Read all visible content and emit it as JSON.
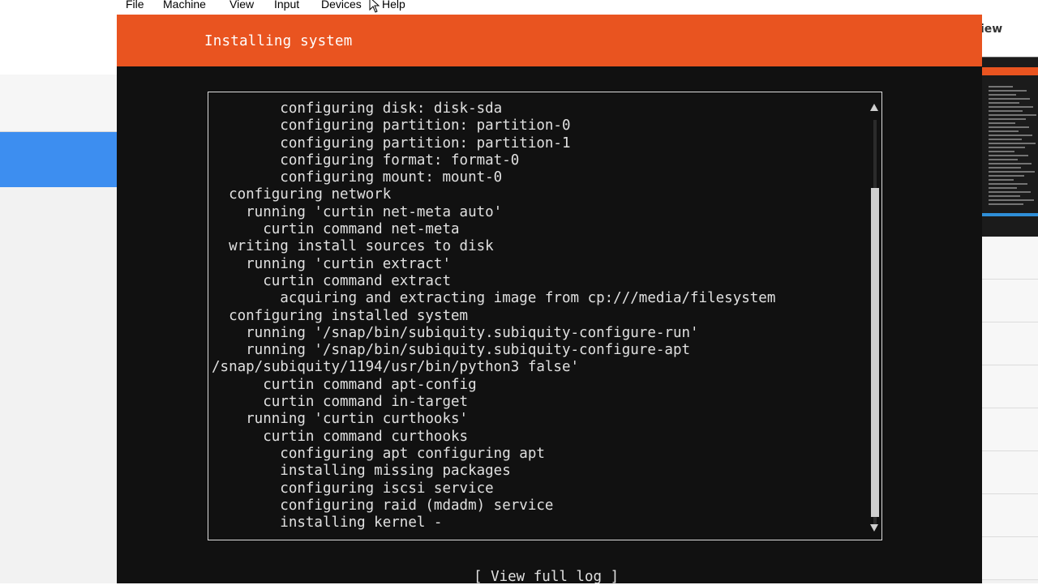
{
  "vm_menu": {
    "items": [
      "File",
      "Machine",
      "View",
      "Input",
      "Devices",
      "Help"
    ]
  },
  "host": {
    "right_label": "iew"
  },
  "installer": {
    "title": "Installing system",
    "log_lines": [
      "        configuring disk: disk-sda",
      "        configuring partition: partition-0",
      "        configuring partition: partition-1",
      "        configuring format: format-0",
      "        configuring mount: mount-0",
      "  configuring network",
      "    running 'curtin net-meta auto'",
      "      curtin command net-meta",
      "  writing install sources to disk",
      "    running 'curtin extract'",
      "      curtin command extract",
      "        acquiring and extracting image from cp:///media/filesystem",
      "  configuring installed system",
      "    running '/snap/bin/subiquity.subiquity-configure-run'",
      "    running '/snap/bin/subiquity.subiquity-configure-apt",
      "/snap/subiquity/1194/usr/bin/python3 false'",
      "      curtin command apt-config",
      "      curtin command in-target",
      "    running 'curtin curthooks'",
      "      curtin command curthooks",
      "        configuring apt configuring apt",
      "        installing missing packages",
      "        configuring iscsi service",
      "        configuring raid (mdadm) service",
      "        installing kernel -"
    ],
    "view_log_label": "[ View full log ]"
  },
  "colors": {
    "ubuntu_orange": "#e95420",
    "terminal_bg": "#111111",
    "terminal_text": "#e0e0e0",
    "host_selected": "#3d8ef0"
  }
}
